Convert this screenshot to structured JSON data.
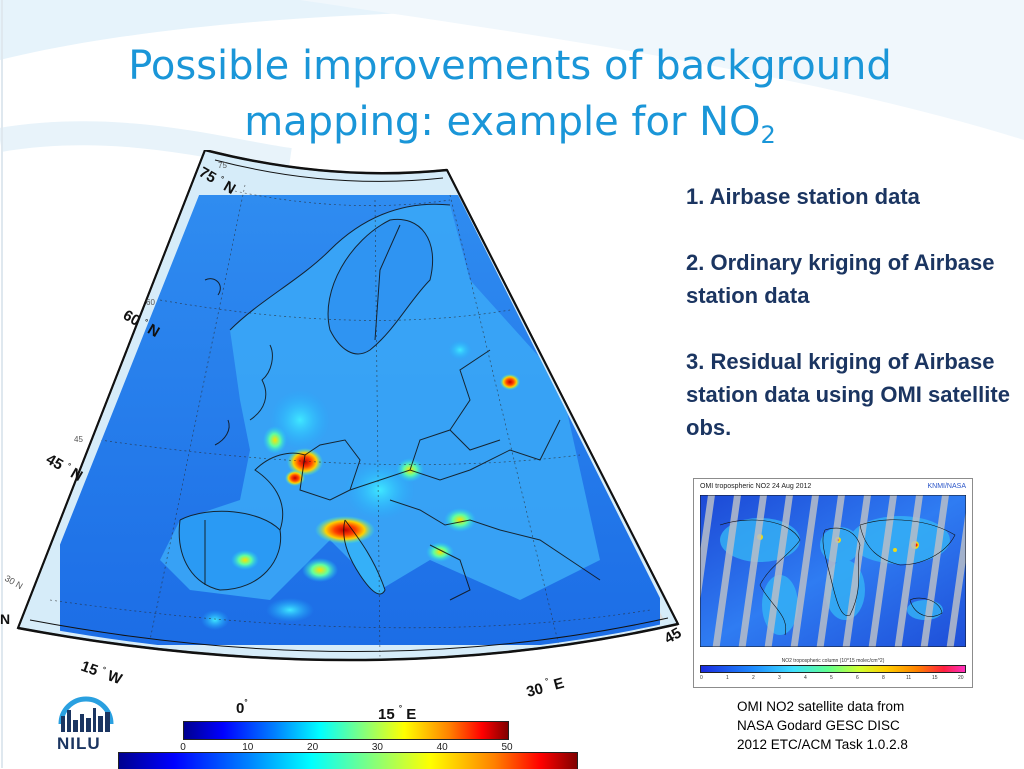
{
  "slide": {
    "title_main": "Possible improvements of background mapping: example for NO",
    "title_sub": "2"
  },
  "map": {
    "lat_labels": [
      {
        "big": "75",
        "small": "75",
        "unit": "N"
      },
      {
        "big": "60",
        "small": "60",
        "unit": "N"
      },
      {
        "big": "45",
        "small": "45",
        "unit": "N"
      },
      {
        "big": "",
        "small": "30",
        "unit": "N"
      }
    ],
    "lon_labels": [
      {
        "value": "15",
        "unit": "W"
      },
      {
        "value": "0",
        "unit": ""
      },
      {
        "value": "15",
        "unit": "E"
      },
      {
        "value": "30",
        "unit": "E"
      },
      {
        "value": "45",
        "unit": ""
      }
    ],
    "colorbar_ticks": [
      "0",
      "10",
      "20",
      "30",
      "40",
      "50"
    ],
    "colors": {
      "ocean_high": "#1a4fe0",
      "ocean_low": "#2aa6f5",
      "land_bg": "#3c9cf0",
      "hotspot": "#ff2000"
    }
  },
  "bullets": [
    "1. Airbase station data",
    "2.  Ordinary kriging  of Airbase station data",
    "3.   Residual kriging of Airbase station data using OMI satellite obs."
  ],
  "satellite_inset": {
    "header": "OMI tropospheric NO2   24 Aug 2012",
    "brand": "KNMI/NASA",
    "units": "NO2 tropospheric column (10^15 molec/cm^2)",
    "ticks": [
      "0",
      "1",
      "2",
      "3",
      "4",
      "5",
      "6",
      "8",
      "11",
      "15",
      "20"
    ]
  },
  "caption": {
    "line1": "OMI NO2  satellite data from",
    "line2": "NASA Godard GESC DISC",
    "line3": "2012 ETC/ACM Task 1.0.2.8"
  },
  "logo": {
    "text": "NILU"
  }
}
